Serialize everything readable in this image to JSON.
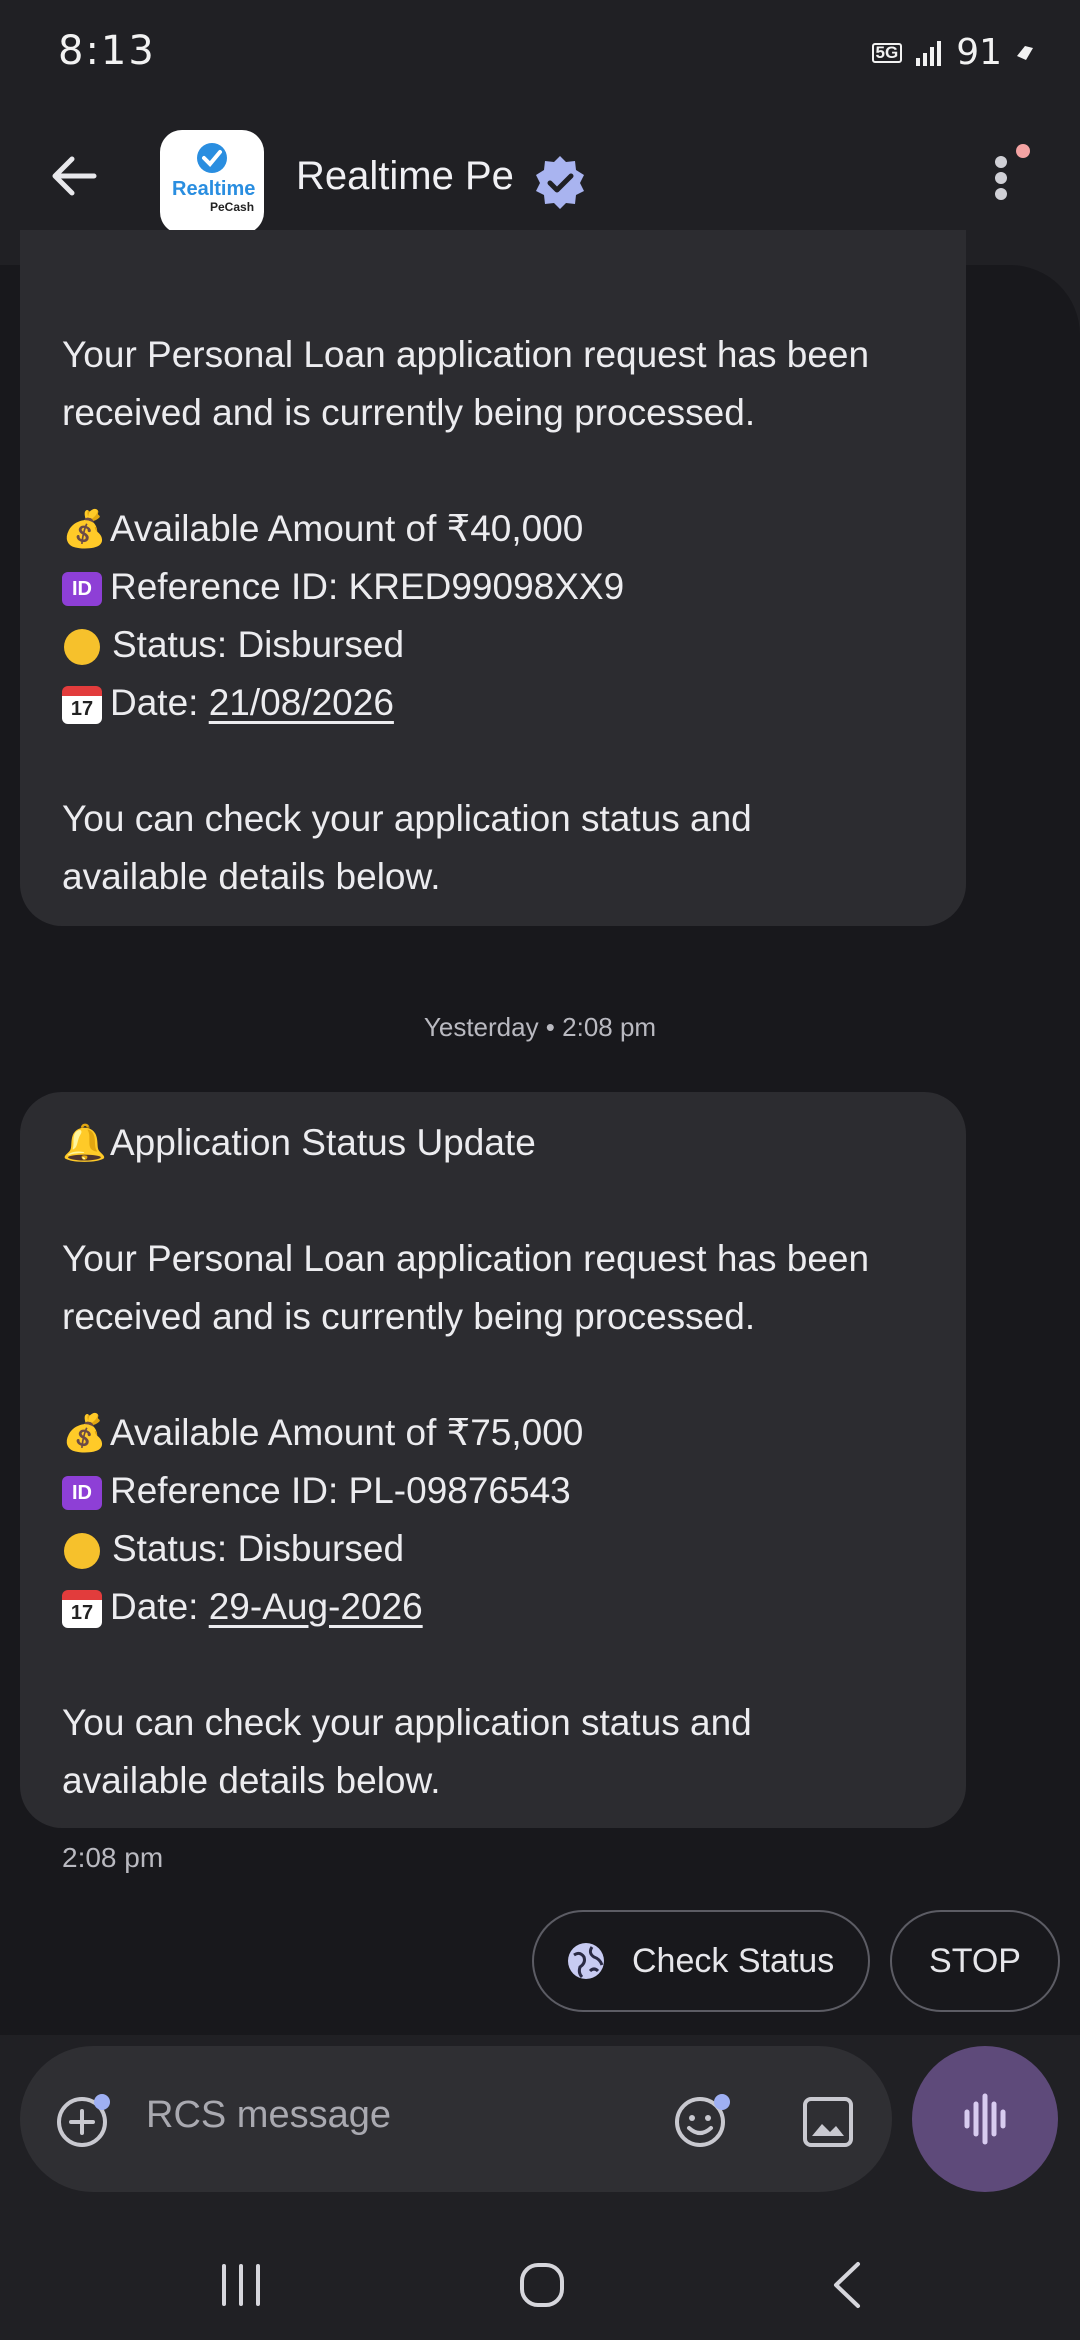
{
  "status_bar": {
    "time": "8:13",
    "network": "5G",
    "battery": "91"
  },
  "header": {
    "title": "Realtime Pe",
    "logo_text": "Realtime",
    "logo_subtext": "PeCash"
  },
  "messages": [
    {
      "lines": [
        "Your Personal Loan application request has been",
        "received and is currently being processed."
      ],
      "amount": "Available Amount of ₹40,000",
      "reference": "Reference ID: KRED99098XX9",
      "status": "Status: Disbursed",
      "date_label": "Date: ",
      "date": "21/08/2026",
      "footer_lines": [
        "You can check your application status and",
        "available details below."
      ]
    },
    {
      "heading": "Application Status Update",
      "lines": [
        "Your Personal Loan application request has been",
        "received and is currently being processed."
      ],
      "amount": "Available Amount of ₹75,000",
      "reference": "Reference ID: PL-09876543",
      "status": "Status: Disbursed",
      "date_label": "Date: ",
      "date": "29-Aug-2026",
      "footer_lines": [
        "You can check your application status and",
        "available details below."
      ]
    }
  ],
  "timestamps": {
    "divider": "Yesterday • 2:08 pm",
    "last_message": "2:08 pm"
  },
  "chips": {
    "check_status": "Check Status",
    "stop": "STOP"
  },
  "composer": {
    "placeholder": "RCS message"
  },
  "icons": {
    "back": "arrow-left-icon",
    "verified": "verified-badge-icon",
    "menu": "more-vert-icon",
    "add": "add-circle-icon",
    "emoji": "emoji-icon",
    "gallery": "image-icon",
    "voice": "voice-wave-icon",
    "globe": "globe-icon",
    "money": "money-bag-emoji",
    "id": "id-emoji",
    "status": "yellow-circle-emoji",
    "calendar": "calendar-emoji",
    "bell": "bell-emoji"
  },
  "calendar_chip": "17",
  "id_chip": "ID",
  "colors": {
    "background": "#202024",
    "bubble": "#2c2c30",
    "accent": "#5e4a7a",
    "verified": "#a9b4f0"
  }
}
